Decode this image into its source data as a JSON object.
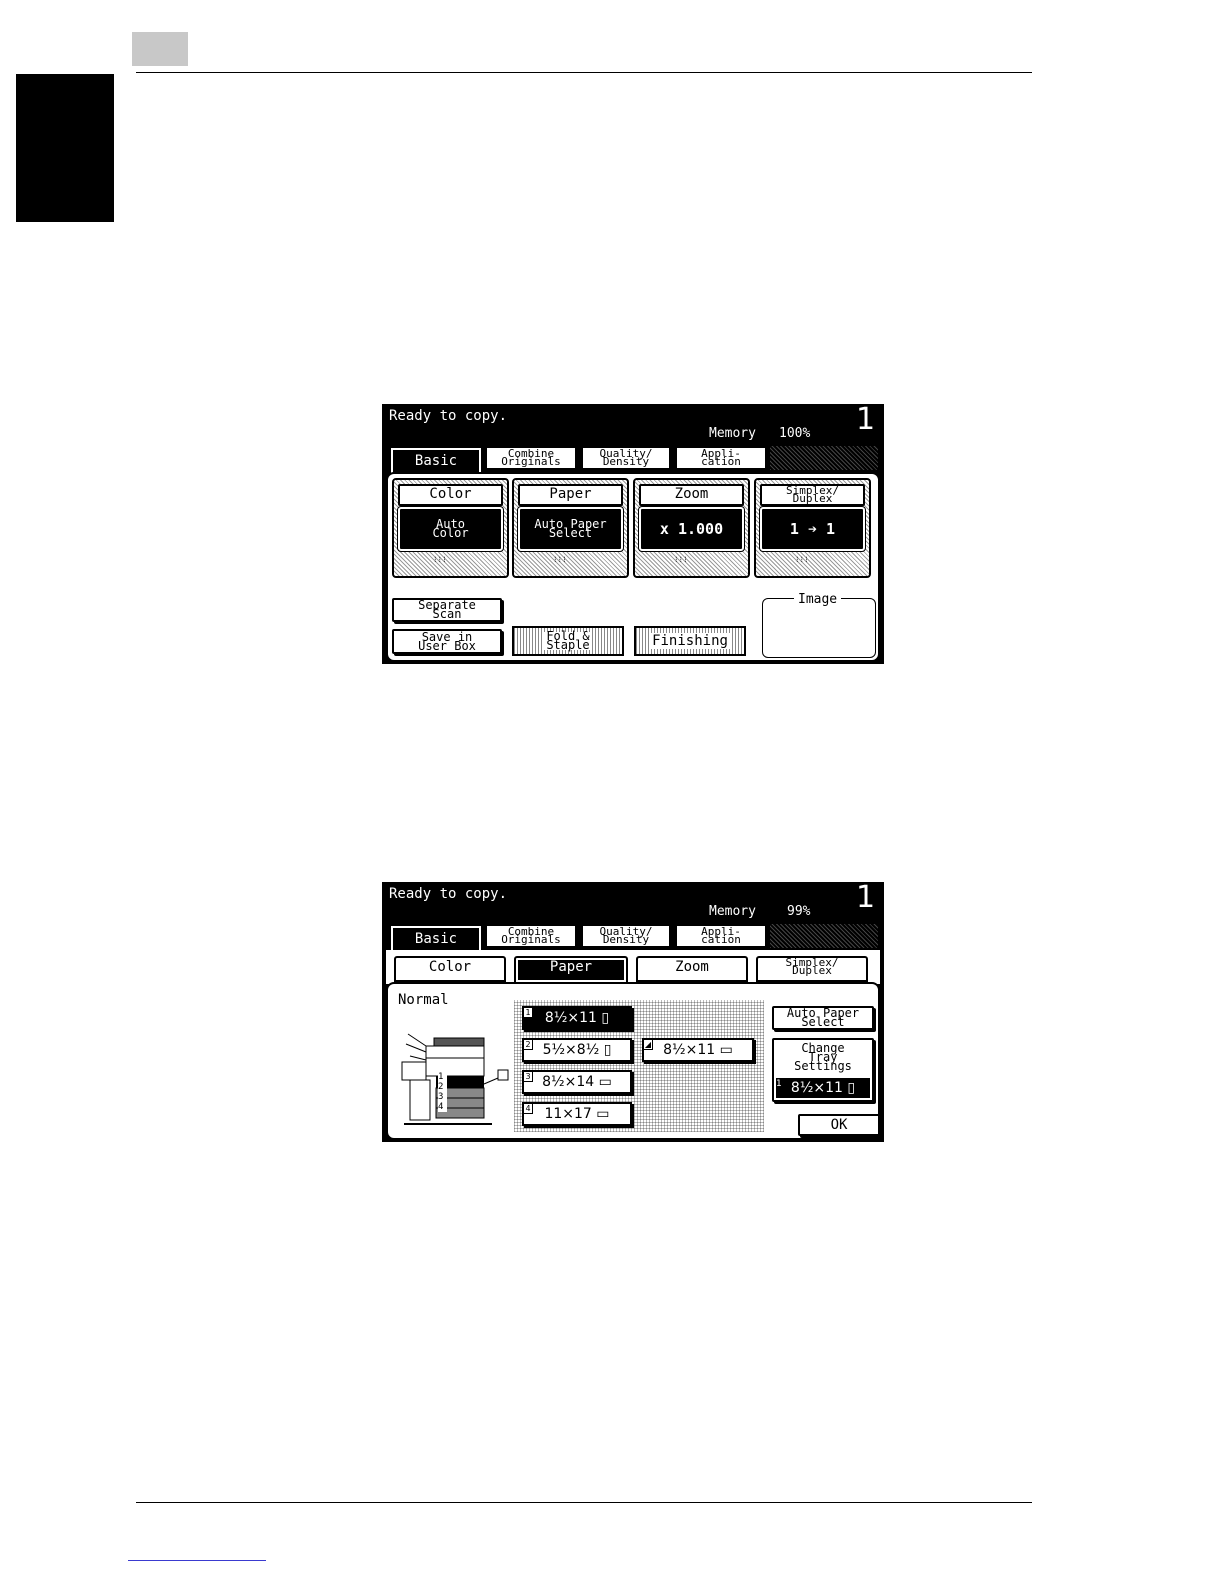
{
  "screens": [
    {
      "status": "Ready to copy.",
      "memory_label": "Memory",
      "memory_value": "100%",
      "copies": "1",
      "tabs": [
        "Basic",
        "Combine\nOriginals",
        "Quality/\nDensity",
        "Appli-\ncation"
      ],
      "functions": [
        {
          "label": "Color",
          "value": "Auto\nColor"
        },
        {
          "label": "Paper",
          "value": "Auto Paper\nSelect"
        },
        {
          "label": "Zoom",
          "value": "x 1.000"
        },
        {
          "label": "Simplex/\nDuplex",
          "value": "1 ➔ 1"
        }
      ],
      "separate_scan": "Separate\nScan",
      "save_user_box": "Save in\nUser Box",
      "fold_staple": "Fold &\nStaple",
      "finishing": "Finishing",
      "image_label": "Image"
    },
    {
      "status": "Ready to copy.",
      "memory_label": "Memory",
      "memory_value": "99%",
      "copies": "1",
      "tabs": [
        "Basic",
        "Combine\nOriginals",
        "Quality/\nDensity",
        "Appli-\ncation"
      ],
      "subtabs": [
        "Color",
        "Paper",
        "Zoom",
        "Simplex/\nDuplex"
      ],
      "normal_label": "Normal",
      "trays": [
        {
          "num": "1",
          "size": "8½×11 ▯"
        },
        {
          "num": "2",
          "size": "5½×8½ ▯"
        },
        {
          "num": "3",
          "size": "8½×14 ▭"
        },
        {
          "num": "4",
          "size": "11×17 ▭"
        }
      ],
      "bypass_tray": "8½×11 ▭",
      "auto_paper_select": "Auto Paper\nSelect",
      "change_tray_settings": "Change\nTray\nSettings",
      "change_tray_value": "8½×11 ▯",
      "change_tray_num": "1",
      "ok": "OK"
    }
  ]
}
